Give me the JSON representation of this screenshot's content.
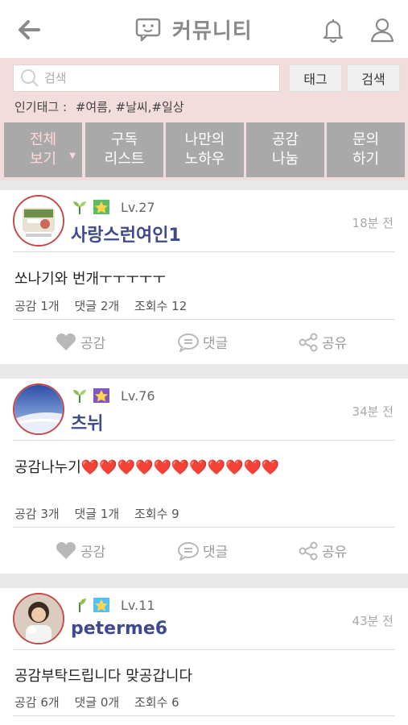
{
  "header": {
    "title": "커뮤니티",
    "icons": [
      "back-arrow-icon",
      "chat-icon",
      "bell-icon",
      "user-icon"
    ]
  },
  "search": {
    "placeholder": "검색",
    "tag_button": "태그",
    "search_button": "검색",
    "popular_label": "인기태그 :",
    "popular_tags": "#여름, #날씨,#일상"
  },
  "tabs": [
    {
      "label": "전체\n보기",
      "active": true
    },
    {
      "label": "구독\n리스트"
    },
    {
      "label": "나만의\n노하우"
    },
    {
      "label": "공감\n나눔"
    },
    {
      "label": "문의\n하기"
    }
  ],
  "colors": {
    "accent_pink": "#f3dcdc",
    "tab_gray": "#a9a9a9",
    "author_blue": "#3f4a8a",
    "heart_red": "#e53935"
  },
  "actions": {
    "like": "공감",
    "comment": "댓글",
    "share": "공유"
  },
  "posts": [
    {
      "level": "Lv.27",
      "author": "사랑스런여인1",
      "time": "18분 전",
      "content": "쏘나기와 번개ㅜㅜㅜㅜㅜ",
      "likes": "공감 1개",
      "comments": "댓글 2개",
      "views": "조회수 12"
    },
    {
      "level": "Lv.76",
      "author": "츠뉘",
      "time": "34분 전",
      "content": "공감나누기❤️❤️❤️❤️❤️❤️❤️❤️❤️❤️❤️",
      "likes": "공감 3개",
      "comments": "댓글 1개",
      "views": "조회수 9"
    },
    {
      "level": "Lv.11",
      "author": "peterme6",
      "time": "43분 전",
      "content": "공감부탁드립니다 맞공갑니다",
      "likes": "공감 6개",
      "comments": "댓글 0개",
      "views": "조회수 6"
    }
  ]
}
